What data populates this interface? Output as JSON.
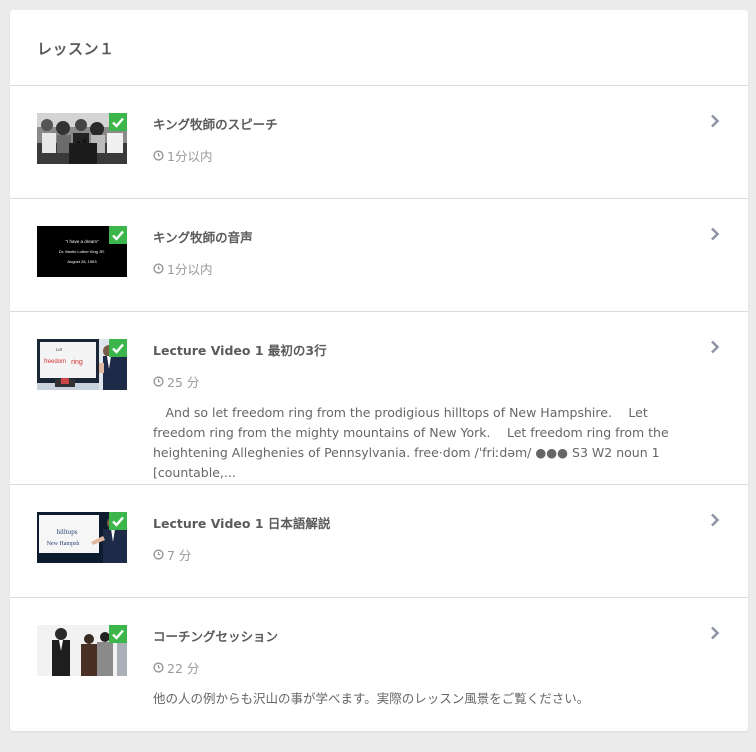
{
  "section": {
    "title": "レッスン１"
  },
  "lessons": [
    {
      "title": "キング牧師のスピーチ",
      "duration": "1分以内",
      "description": "",
      "completed": true,
      "thumbnail_icon": "speech-crowd-photo"
    },
    {
      "title": "キング牧師の音声",
      "duration": "1分以内",
      "description": "",
      "completed": true,
      "thumbnail_icon": "audio-title-card",
      "thumb_text": [
        "\"I have a dream\"",
        "Dr. Martin Luther King JR.",
        "August 28, 1963"
      ]
    },
    {
      "title": "Lecture Video 1 最初の3行",
      "duration": "25 分",
      "description": "　And so let freedom ring from the prodigious hilltops of New Hampshire.　 Let freedom ring from the mighty mountains of New York.　 Let freedom ring from the heightening Alleghenies of Pennsylvania. free·dom /ˈfriːdəm/ ●●● S3 W2 noun 1 [countable,...",
      "completed": true,
      "thumbnail_icon": "lecture-video-presenter",
      "thumb_text": [
        "Let",
        "freedom",
        "ring"
      ]
    },
    {
      "title": "Lecture Video 1 日本語解説",
      "duration": "7 分",
      "description": "",
      "completed": true,
      "thumbnail_icon": "lecture-video-screen",
      "thumb_text": [
        "hilltops",
        "New Hampsh"
      ]
    },
    {
      "title": "コーチングセッション",
      "duration": "22 分",
      "description": "他の人の例からも沢山の事が学べます。実際のレッスン風景をご覧ください。",
      "completed": true,
      "thumbnail_icon": "coaching-group-photo"
    }
  ],
  "colors": {
    "check": "#3cb64a",
    "chevron": "#8f96a3"
  }
}
